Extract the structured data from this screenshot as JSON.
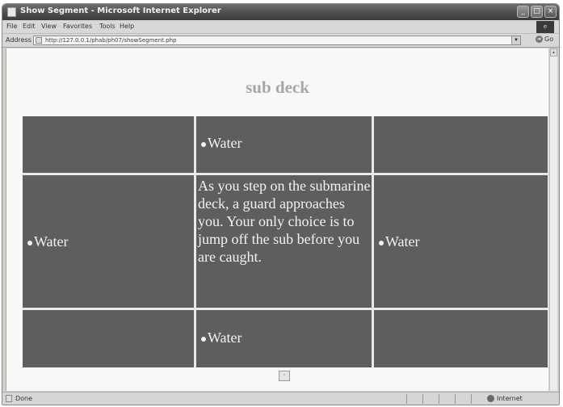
{
  "window": {
    "title": "Show Segment - Microsoft Internet Explorer",
    "minimize_glyph": "_",
    "maximize_glyph": "□",
    "close_glyph": "×",
    "brand_glyph": "e"
  },
  "menu": {
    "items": [
      "File",
      "Edit",
      "View",
      "Favorites",
      "Tools",
      "Help"
    ]
  },
  "address": {
    "label": "Address",
    "url": "http://127.0.0.1/phab/ph07/showSegment.php",
    "go_label": "Go"
  },
  "page": {
    "title": "sub deck",
    "grid": {
      "top_center": "Water",
      "middle_left": "Water",
      "middle_center": "As you step on the submarine deck, a guard approaches you. Your only choice is to jump off the sub before you are caught.",
      "middle_right": "Water",
      "bottom_center": "Water"
    },
    "image_glyph": "▫"
  },
  "status": {
    "text": "Done",
    "zone": "Internet"
  },
  "colors": {
    "cell_bg": "#5e5e5e",
    "title_color": "#a6a6a6",
    "titlebar": "#4a4a4a"
  }
}
